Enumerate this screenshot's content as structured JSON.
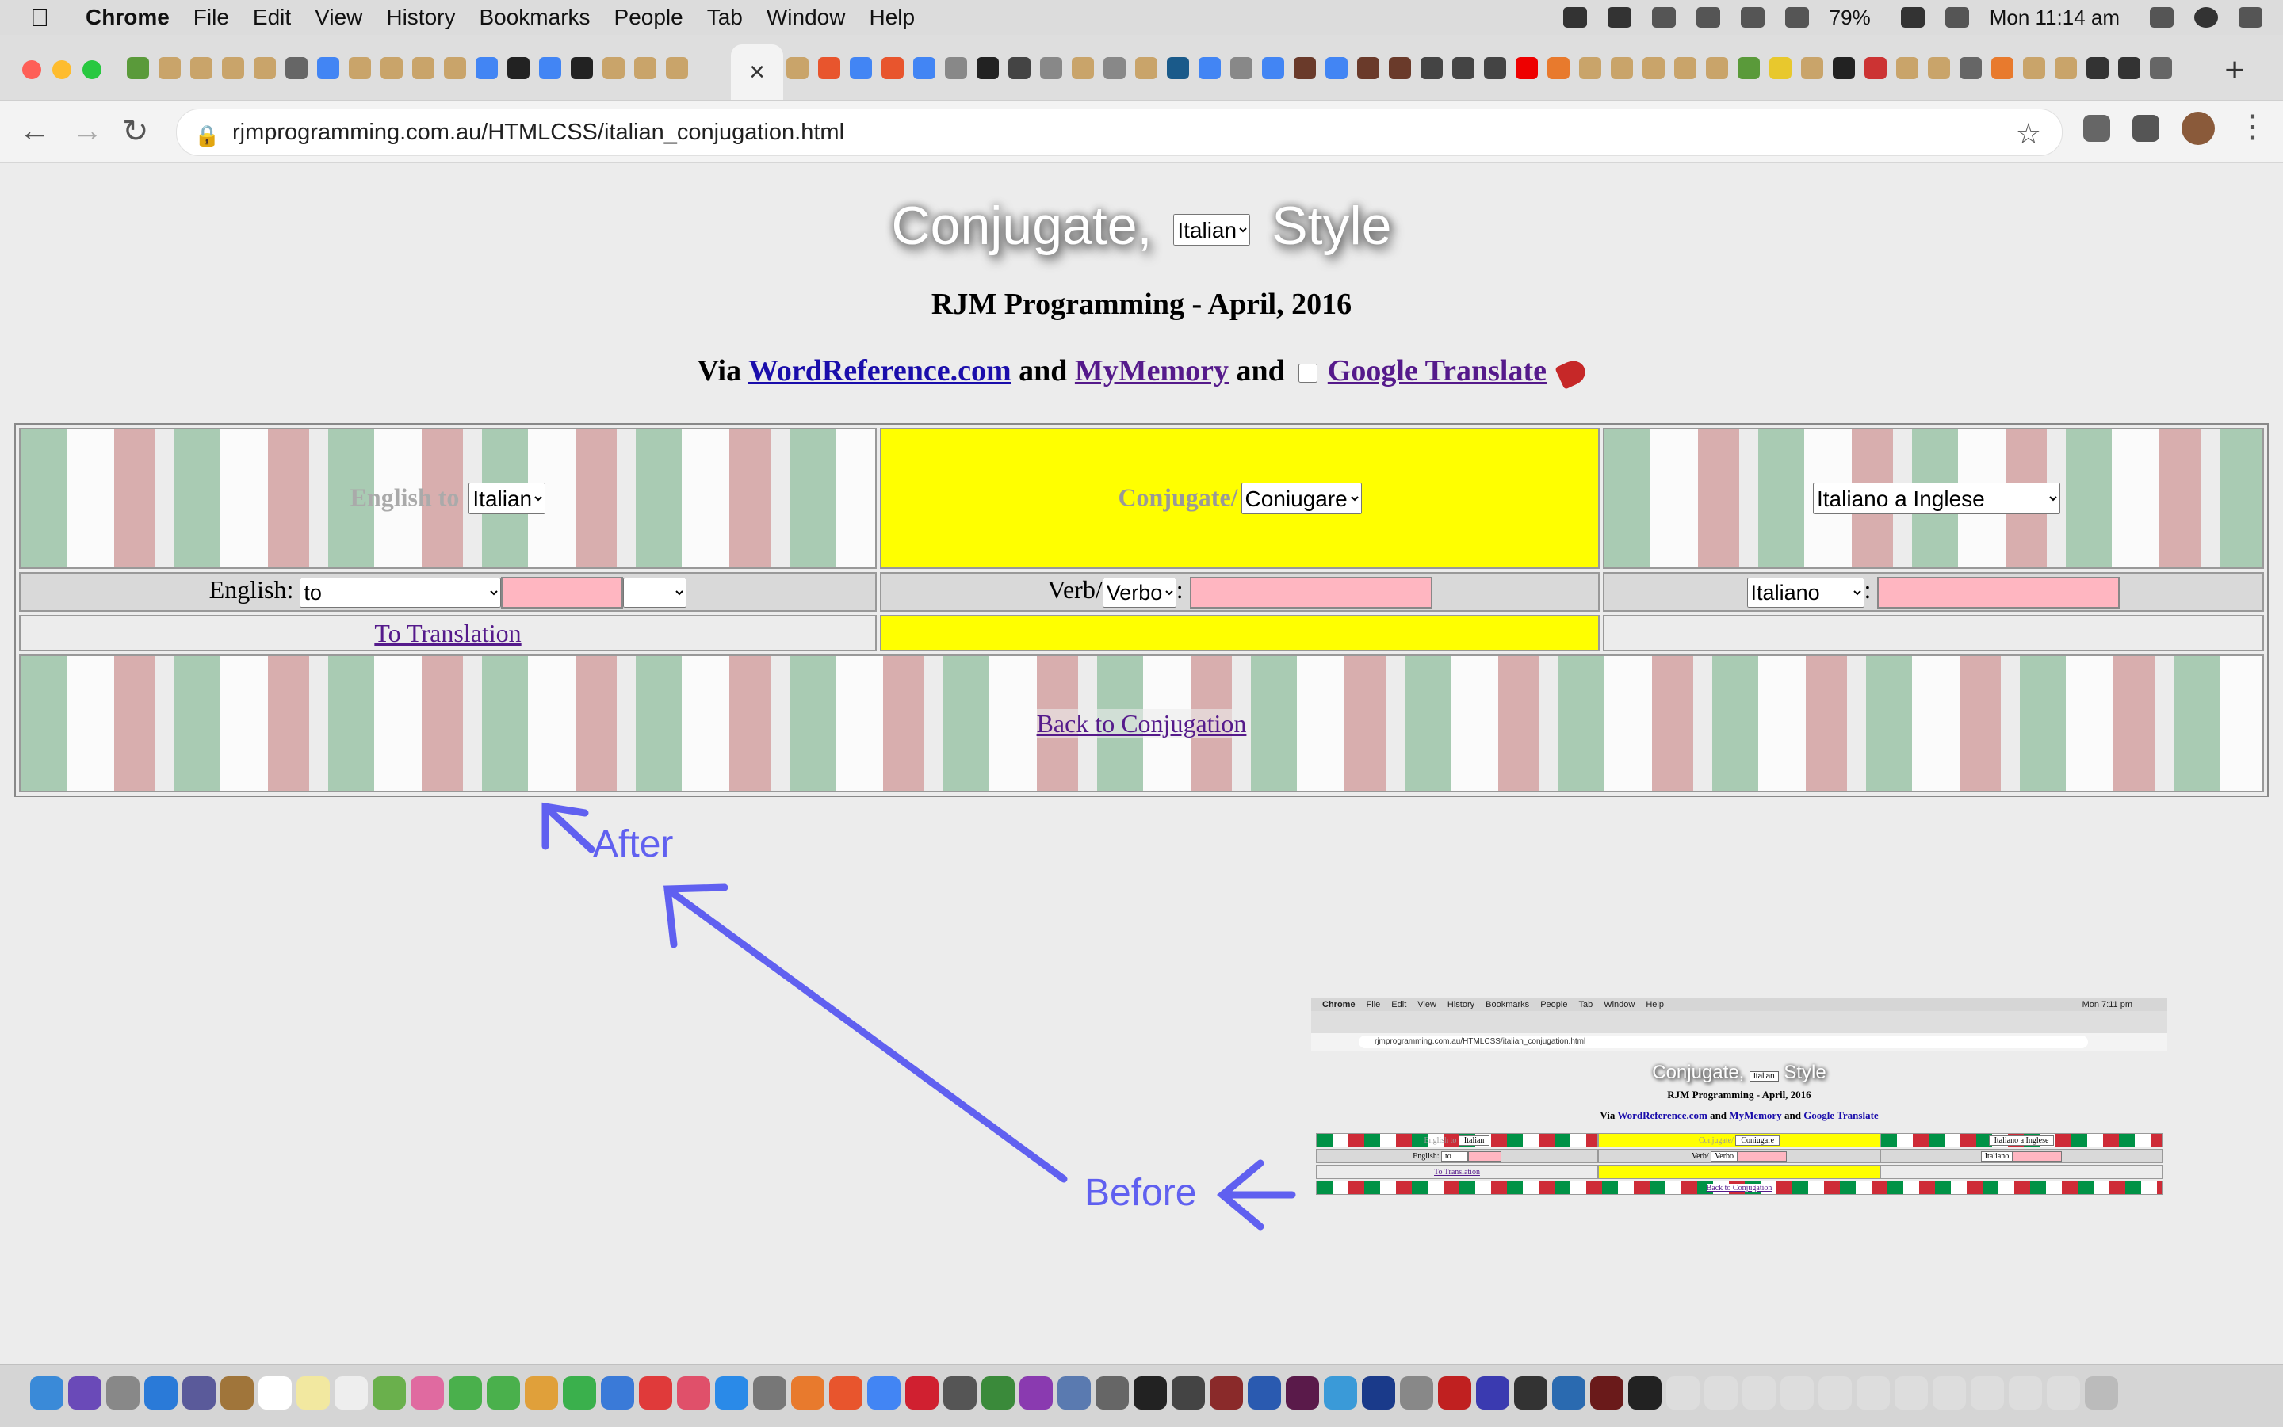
{
  "menubar": {
    "app": "Chrome",
    "items": [
      "File",
      "Edit",
      "View",
      "History",
      "Bookmarks",
      "People",
      "Tab",
      "Window",
      "Help"
    ],
    "battery": "79%",
    "clock": "Mon 11:14 am"
  },
  "browser": {
    "url": "rjmprogramming.com.au/HTMLCSS/italian_conjugation.html",
    "active_tab_close": "×",
    "new_tab": "+"
  },
  "page": {
    "title_left": "Conjugate,",
    "title_right": "Style",
    "language_selected": "Italian",
    "subtitle": "RJM Programming - April, 2016",
    "via_prefix": "Via",
    "via_link1": "WordReference.com",
    "via_and1": "and",
    "via_link2": "MyMemory",
    "via_and2": "and",
    "via_link3": "Google Translate",
    "panel1": {
      "label": "English to",
      "select": "Italian"
    },
    "panel2": {
      "label": "Conjugate/",
      "select": "Coniugare"
    },
    "panel3": {
      "select": "Italiano a Inglese"
    },
    "row2": {
      "english_label": "English:",
      "english_select": "to",
      "verb_label": "Verb/",
      "verb_select": "Verbo",
      "colon": ":",
      "italiano_select": "Italiano",
      "colon2": ":"
    },
    "to_translation": "To Translation",
    "back_to_conjugation": "Back to Conjugation"
  },
  "annotations": {
    "after": "After",
    "before": "Before"
  },
  "thumbnail": {
    "menubar_items": [
      "Chrome",
      "File",
      "Edit",
      "View",
      "History",
      "Bookmarks",
      "People",
      "Tab",
      "Window",
      "Help"
    ],
    "clock": "Mon 7:11 pm",
    "url": "rjmprogramming.com.au/HTMLCSS/italian_conjugation.html",
    "title_left": "Conjugate,",
    "title_select": "Italian",
    "title_right": "Style",
    "subtitle": "RJM Programming - April, 2016",
    "via_prefix": "Via",
    "via_link1": "WordReference.com",
    "via_and1": "and",
    "via_link2": "MyMemory",
    "via_and2": "and",
    "via_link3": "Google Translate",
    "english_to": "English to",
    "english_select": "Italian",
    "conjugate": "Conjugate/",
    "conjugate_select": "Coniugare",
    "italiano_a_inglese": "Italiano a Inglese",
    "english_label": "English:",
    "english_to_select": "to",
    "verb_label": "Verb/",
    "verb_select": "Verbo",
    "italiano_select": "Italiano",
    "to_translation": "To Translation",
    "back_to_conjugation": "Back to Conjugation"
  },
  "colors": {
    "annotation": "#6060f0",
    "yellow_cell": "#ffff00",
    "pink_input": "#ffb6c1",
    "link_visited": "#551a8b",
    "link": "#1a0dab"
  }
}
